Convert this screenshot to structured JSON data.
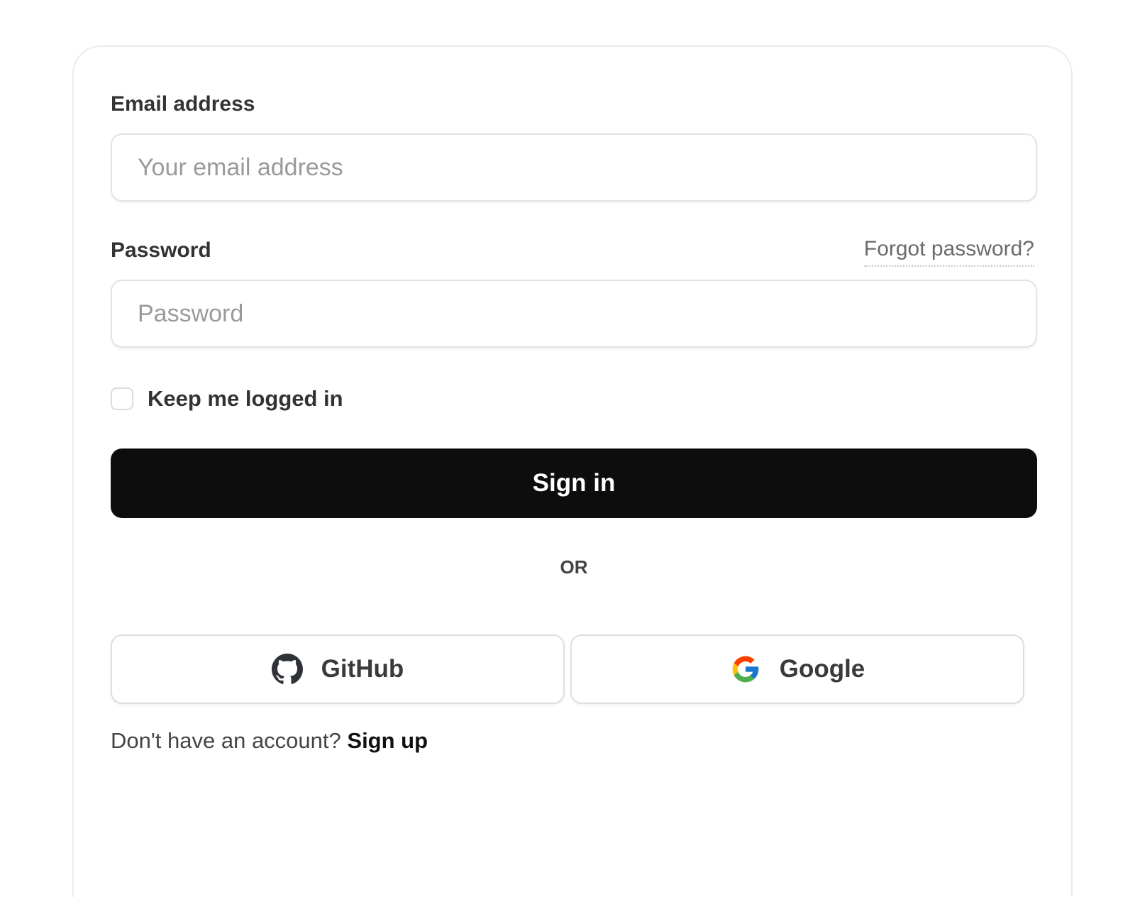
{
  "form": {
    "email_label": "Email address",
    "email_placeholder": "Your email address",
    "password_label": "Password",
    "forgot_link": "Forgot password?",
    "password_placeholder": "Password",
    "remember_label": "Keep me logged in",
    "submit_label": "Sign in",
    "divider": "OR"
  },
  "oauth": {
    "github_label": "GitHub",
    "github_icon": "github-icon",
    "google_label": "Google",
    "google_icon": "google-icon"
  },
  "footer": {
    "prompt": "Don't have an account?",
    "signup_link": "Sign up"
  },
  "colors": {
    "primary_button": "#0d0d0d",
    "border": "#e3e3e3",
    "placeholder": "#9a9a9a"
  }
}
